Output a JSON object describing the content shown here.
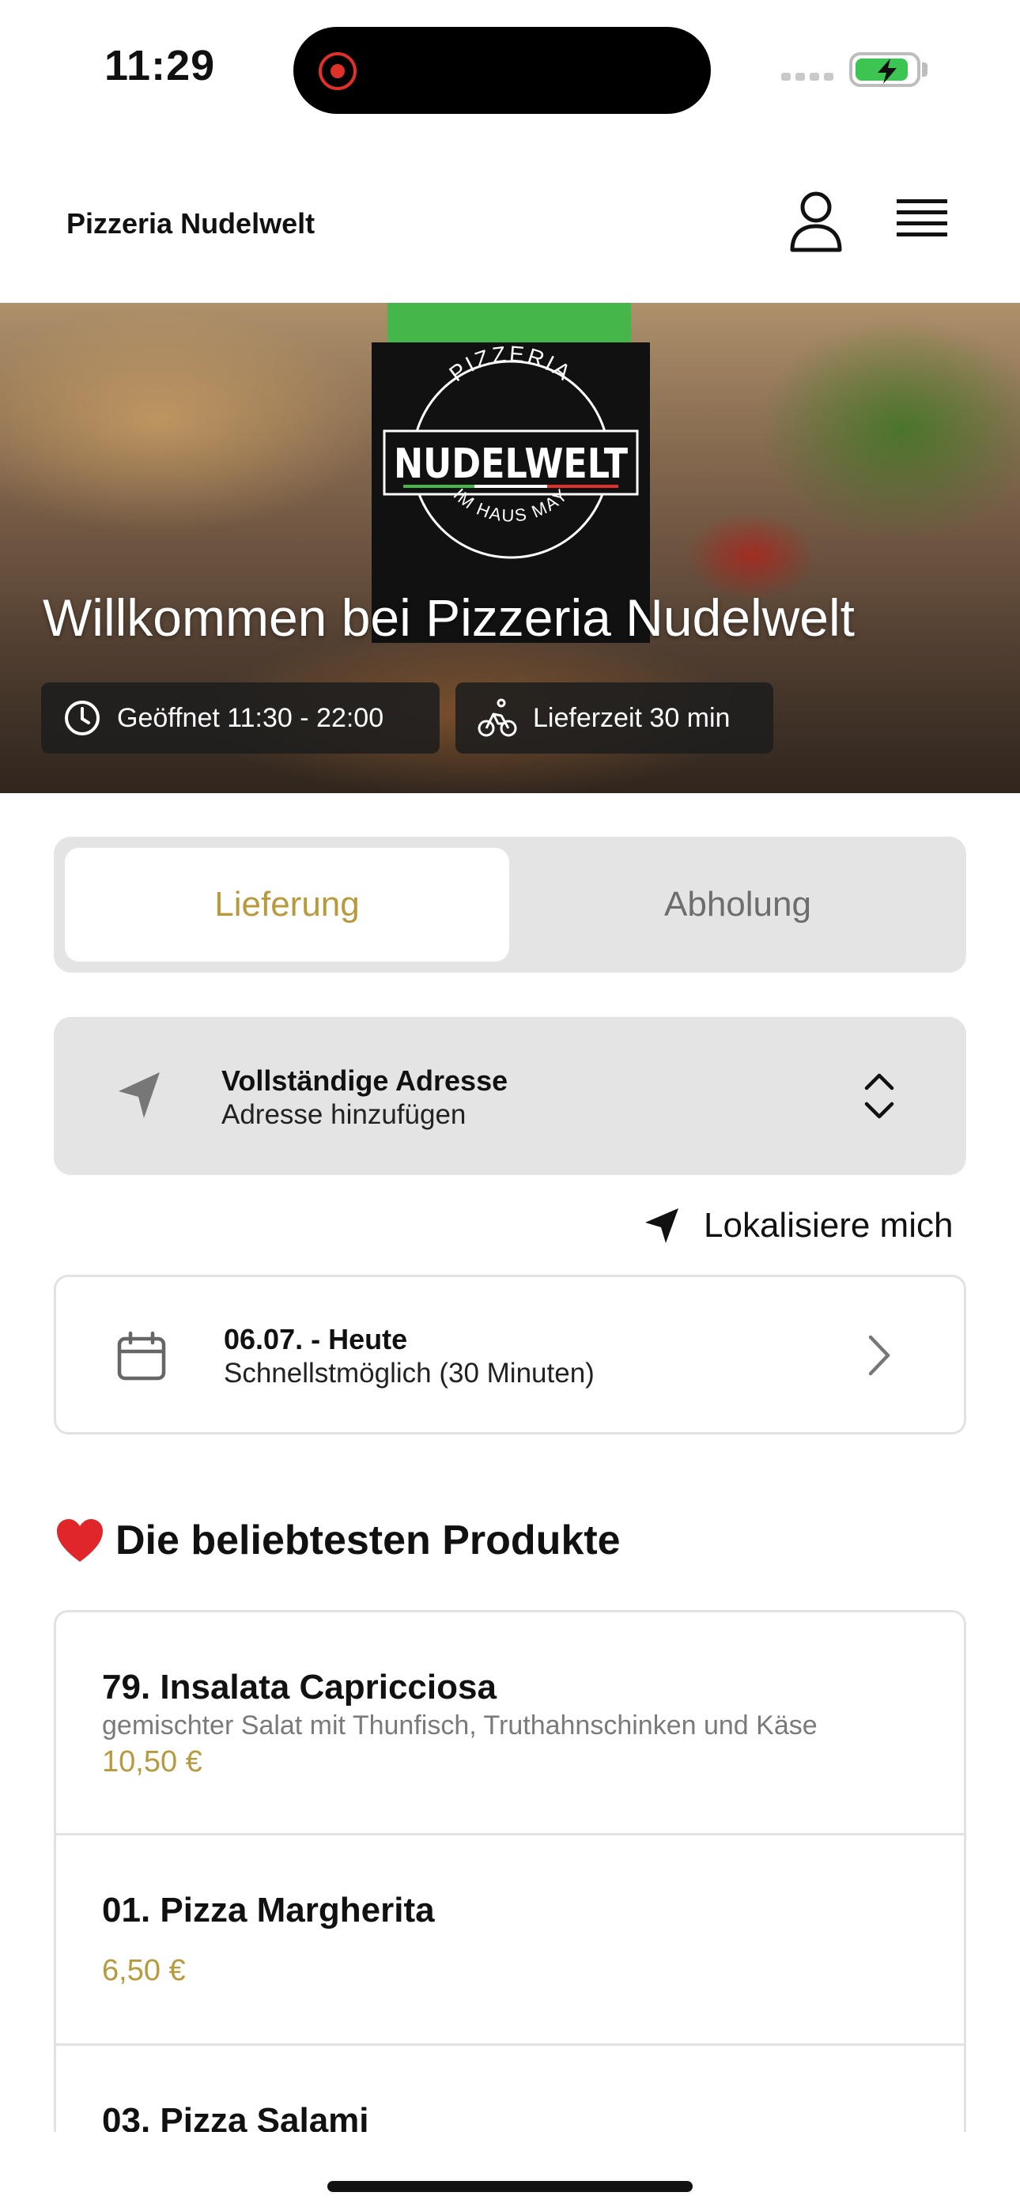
{
  "status_bar": {
    "time": "11:29"
  },
  "header": {
    "title": "Pizzeria Nudelwelt",
    "icons": [
      "user-icon",
      "hamburger-menu-icon"
    ]
  },
  "hero": {
    "logo": {
      "top": "PIZZERIA",
      "main": "NUDELWELT",
      "bottom": "IM HAUS MAY"
    },
    "title": "Willkommen bei Pizzeria Nudelwelt",
    "hours_chip": {
      "label": "Geöffnet 11:30 - 22:00",
      "icon": "clock-icon"
    },
    "delivery_chip": {
      "label": "Lieferzeit 30 min",
      "icon": "bicycle-icon"
    }
  },
  "order_mode": {
    "tabs": [
      "Lieferung",
      "Abholung"
    ],
    "active": "Lieferung"
  },
  "address": {
    "title": "Vollständige Adresse",
    "subtitle": "Adresse hinzufügen",
    "icon": "location-arrow-icon"
  },
  "locate_me": {
    "label": "Lokalisiere mich",
    "icon": "location-arrow-icon"
  },
  "schedule": {
    "title": "06.07. - Heute",
    "subtitle": "Schnellstmöglich (30 Minuten)",
    "icon": "calendar-icon"
  },
  "popular": {
    "title": "Die beliebtesten Produkte",
    "icon": "heart-icon",
    "products": [
      {
        "name": "79. Insalata Capricciosa",
        "description": "gemischter Salat mit Thunfisch, Truthahnschinken und Käse",
        "price": "10,50 €"
      },
      {
        "name": "01. Pizza Margherita",
        "description": "",
        "price": "6,50 €"
      },
      {
        "name": "03. Pizza Salami",
        "description": "",
        "price": ""
      }
    ]
  },
  "colors": {
    "accent": "#b89a3e",
    "card_bg": "#e4e4e4",
    "logo_green": "#45b64a",
    "logo_red": "#e0302a"
  }
}
